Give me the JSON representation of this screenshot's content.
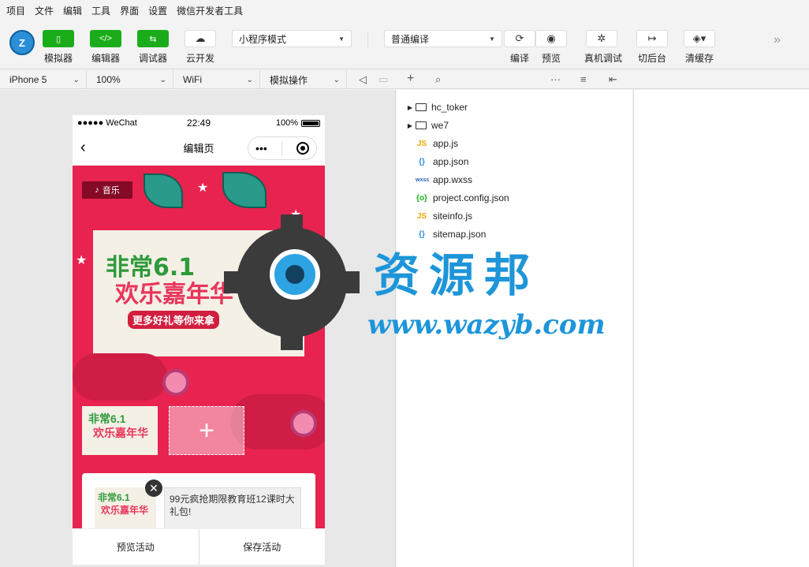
{
  "menu": [
    "项目",
    "文件",
    "编辑",
    "工具",
    "界面",
    "设置",
    "微信开发者工具"
  ],
  "toolbar": {
    "simulator": "模拟器",
    "editor": "编辑器",
    "debugger": "调试器",
    "cloud": "云开发",
    "mode_select": "小程序模式",
    "compile_select": "普通编译",
    "compile": "编译",
    "preview": "预览",
    "real_debug": "真机调试",
    "background": "切后台",
    "clear_cache": "清缓存"
  },
  "subbar": {
    "device": "iPhone 5",
    "zoom": "100%",
    "network": "WiFi",
    "operation": "模拟操作"
  },
  "phone": {
    "carrier": "●●●●● WeChat",
    "time": "22:49",
    "battery": "100%",
    "nav_title": "编辑页",
    "music_tag": "音乐",
    "poster_line1": "非常6.1",
    "poster_line2": "欢乐嘉年华",
    "poster_line3": "更多好礼等你来拿",
    "thumb_line1": "非常6.1",
    "thumb_line2": "欢乐嘉年华",
    "card_text": "99元疯抢期限教育班12课时大礼包!",
    "card_img_line1": "非常6.1",
    "card_img_line2": "欢乐嘉年华",
    "btn_preview": "预览活动",
    "btn_save": "保存活动"
  },
  "files": [
    {
      "name": "hc_toker",
      "type": "folder"
    },
    {
      "name": "we7",
      "type": "folder"
    },
    {
      "name": "app.js",
      "type": "js"
    },
    {
      "name": "app.json",
      "type": "json"
    },
    {
      "name": "app.wxss",
      "type": "wxss"
    },
    {
      "name": "project.config.json",
      "type": "config"
    },
    {
      "name": "siteinfo.js",
      "type": "js"
    },
    {
      "name": "sitemap.json",
      "type": "json"
    }
  ],
  "watermark": {
    "title": "资源邦",
    "url": "www.wazyb.com"
  },
  "colors": {
    "green": "#1aad19",
    "poster_bg": "#e8234f",
    "watermark_blue": "#1e95d9"
  }
}
